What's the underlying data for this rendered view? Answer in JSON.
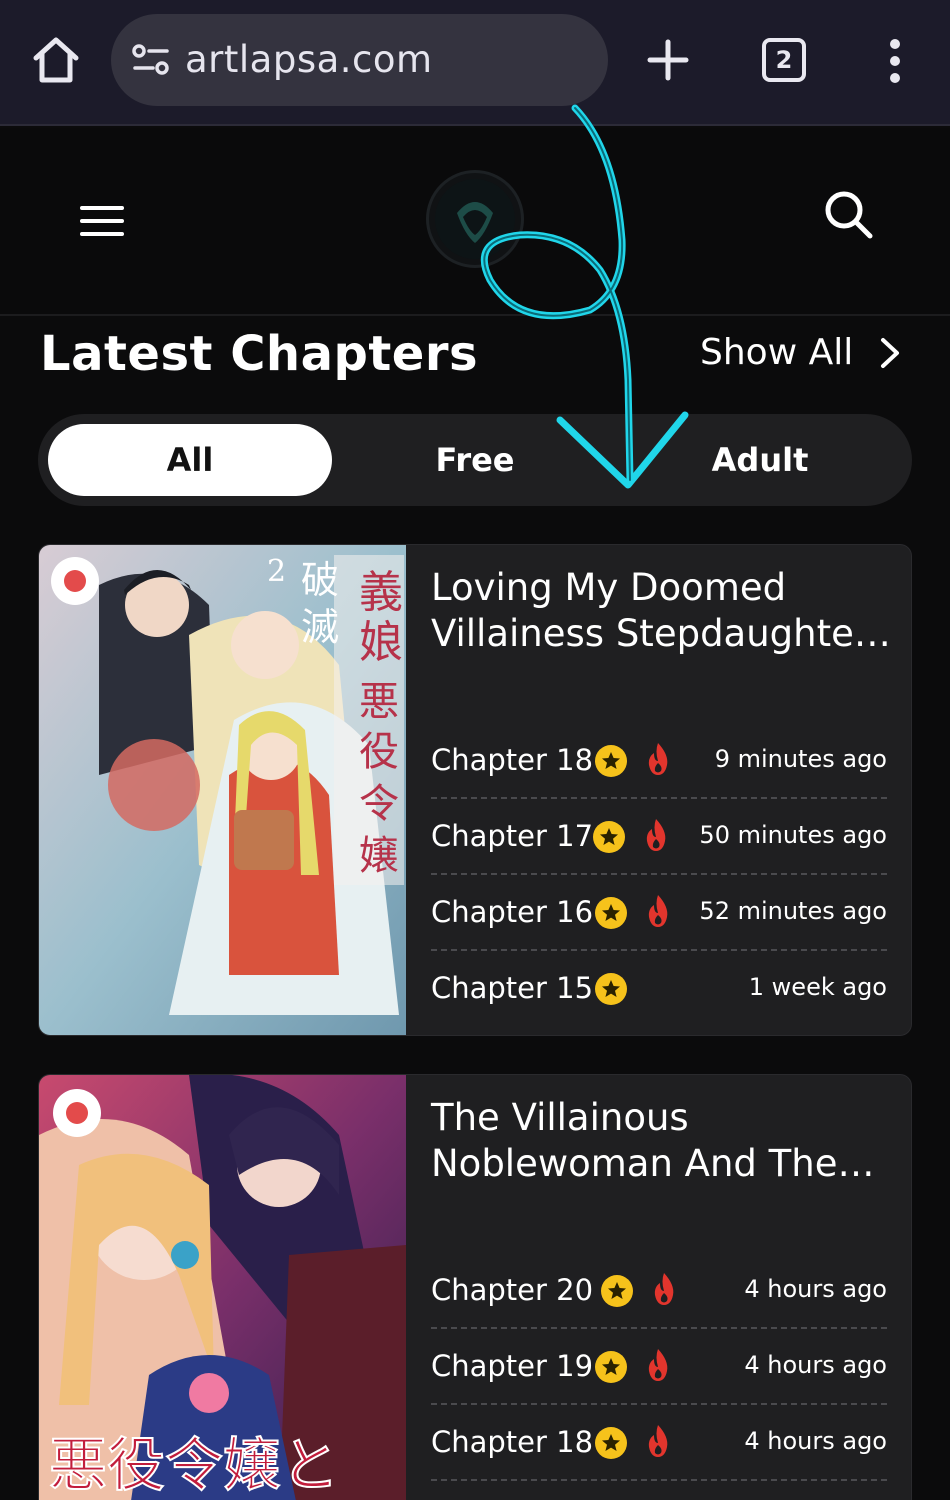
{
  "browser": {
    "url": "artlapsa.com",
    "tab_count": "2",
    "icons": [
      "home-icon",
      "site-settings-icon",
      "new-tab-icon",
      "tab-switcher-icon",
      "more-menu-icon"
    ]
  },
  "site": {
    "icons": [
      "hamburger-menu-icon",
      "site-logo",
      "search-icon"
    ]
  },
  "section": {
    "title": "Latest Chapters",
    "show_all": "Show All"
  },
  "filters": {
    "tabs": [
      {
        "label": "All",
        "active": true
      },
      {
        "label": "Free",
        "active": false
      },
      {
        "label": "Adult",
        "active": false
      }
    ]
  },
  "colors": {
    "premium_star": "#f6c21b",
    "hot_fire": "#e2352d",
    "annotation_arrow": "#20d6ea"
  },
  "series": [
    {
      "title": "Loving My Doomed Villainess Stepdaughte...",
      "title_line1": "Loving My Doomed",
      "title_line2": "Villainess Stepdaughte…",
      "cover_text": "義娘が悪役令嬢",
      "chapters": [
        {
          "name": "Chapter 18",
          "time": "9 minutes ago",
          "premium": true,
          "hot": true
        },
        {
          "name": "Chapter 17",
          "time": "50 minutes ago",
          "premium": true,
          "hot": true
        },
        {
          "name": "Chapter 16",
          "time": "52 minutes ago",
          "premium": true,
          "hot": true
        },
        {
          "name": "Chapter 15",
          "time": "1 week ago",
          "premium": true,
          "hot": false
        }
      ]
    },
    {
      "title_line1": "The Villainous",
      "title_line2": "Noblewoman And The…",
      "cover_text": "悪役令嬢と",
      "chapters": [
        {
          "name": "Chapter 20",
          "time": "4 hours ago",
          "premium": true,
          "hot": true
        },
        {
          "name": "Chapter 19",
          "time": "4 hours ago",
          "premium": true,
          "hot": true
        },
        {
          "name": "Chapter 18",
          "time": "4 hours ago",
          "premium": true,
          "hot": true
        }
      ]
    }
  ]
}
